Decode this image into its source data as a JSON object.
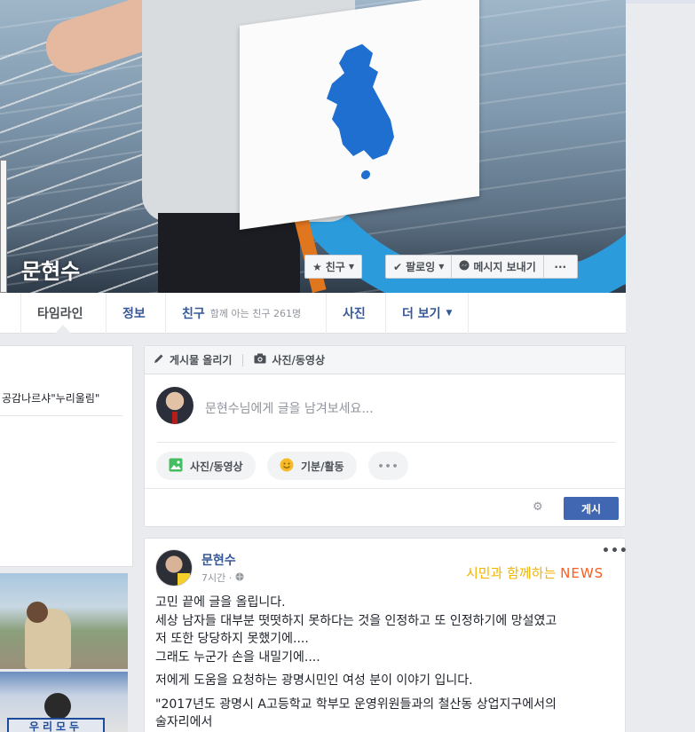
{
  "profile": {
    "name": "문현수"
  },
  "cover_buttons": {
    "friend": "친구",
    "following": "팔로잉",
    "message": "메시지 보내기",
    "more": "···"
  },
  "nav": {
    "timeline": "타임라인",
    "info": "정보",
    "friends": "친구",
    "friends_sub": "함께 아는 친구 261명",
    "photos": "사진",
    "more": "더 보기"
  },
  "left": {
    "intro_text": "공감나르샤\"누리울림\"",
    "photo_banner": "우리모두"
  },
  "composer": {
    "tab_post": "게시물 올리기",
    "tab_photo": "사진/동영상",
    "placeholder": "문현수님에게 글을 남겨보세요...",
    "pill_photo": "사진/동영상",
    "pill_feeling": "기분/활동",
    "pill_more": "•••",
    "post_button": "게시"
  },
  "story": {
    "author": "문현수",
    "time": "7시간",
    "more": "•••",
    "watermark_a": "시민과 함께하는 ",
    "watermark_b": "NEWS",
    "lines": [
      "고민 끝에 글을 올립니다.",
      "세상 남자들 대부분 떳떳하지 못하다는 것을 인정하고 또 인정하기에 망설였고",
      "저 또한 당당하지 못했기에....",
      "그래도 누군가 손을 내밀기에....",
      "저에게 도움을 요청하는 광명시민인 여성 분이 이야기 입니다.",
      "\"2017년도 광명시 A고등학교 학부모 운영위원들과의 철산동 상업지구에서의",
      "술자리에서"
    ]
  },
  "colors": {
    "link_blue": "#365899",
    "primary_button": "#4267b2",
    "cover_ring": "#2b9bdc"
  }
}
